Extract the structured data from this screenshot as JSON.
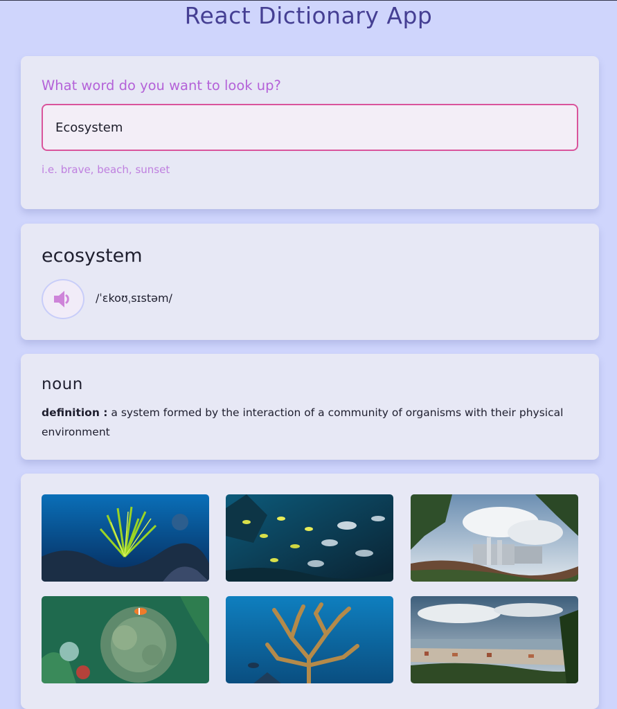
{
  "app": {
    "title": "React Dictionary App"
  },
  "search": {
    "question": "What word do you want to look up?",
    "value": "Ecosystem",
    "hint": "i.e. brave, beach, sunset"
  },
  "result": {
    "word": "ecosystem",
    "audio_icon": "speaker-icon",
    "phonetic": "/ˈɛkoʊˌsɪstəm/"
  },
  "meaning": {
    "part_of_speech": "noun",
    "definition_label": "definition :",
    "definition_text": "a system formed by the interaction of a community of organisms with their physical environment"
  },
  "photos": [
    {
      "subject": "coral-reef-feather-star"
    },
    {
      "subject": "school-of-fish"
    },
    {
      "subject": "coastal-city-skyline"
    },
    {
      "subject": "clownfish-anemone"
    },
    {
      "subject": "branching-coral"
    },
    {
      "subject": "city-bay-panorama"
    }
  ],
  "colors": {
    "background": "#cfd5fc",
    "card": "#e7e8f5",
    "title": "#453f93",
    "accent": "#b462d8",
    "input_border": "#d9549b"
  }
}
